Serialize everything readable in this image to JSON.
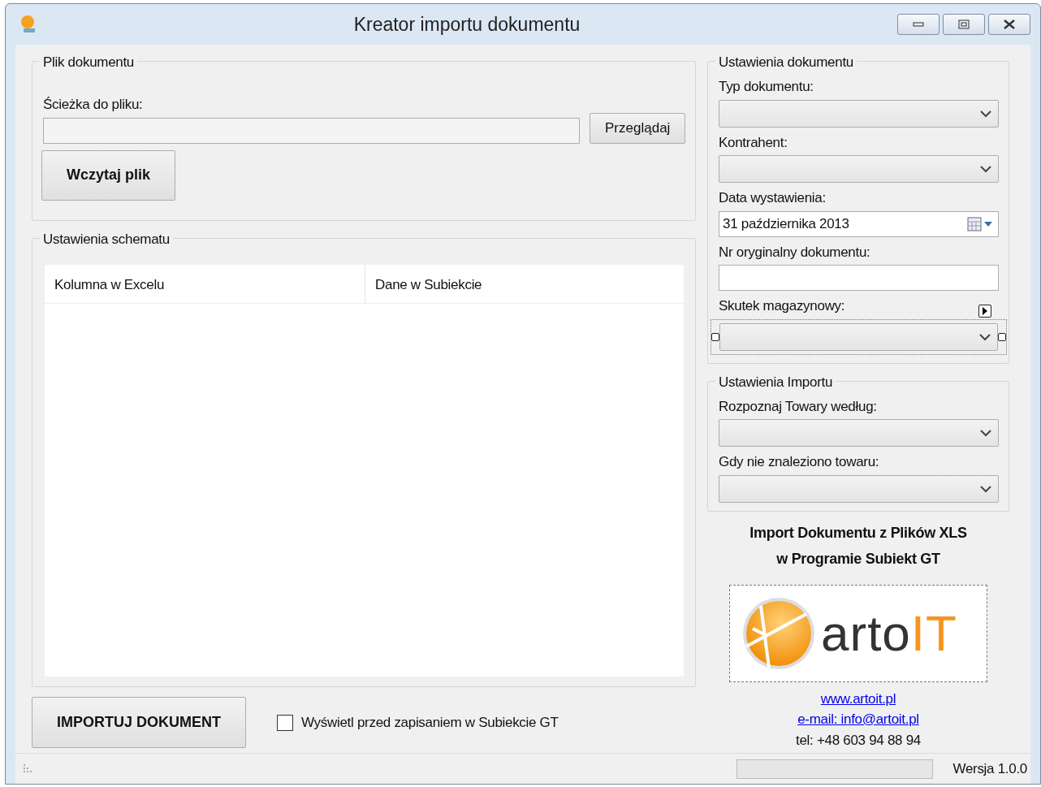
{
  "window": {
    "title": "Kreator importu dokumentu"
  },
  "file_group": {
    "title": "Plik dokumentu",
    "path_label": "Ścieżka do pliku:",
    "browse_button": "Przeglądaj",
    "load_button": "Wczytaj plik"
  },
  "schema_group": {
    "title": "Ustawienia schematu",
    "columns": [
      "Kolumna w Excelu",
      "Dane w Subiekcie"
    ]
  },
  "document_settings": {
    "title": "Ustawienia dokumentu",
    "fields": [
      {
        "kind": "combo",
        "label": "Typ dokumentu:",
        "selected": false
      },
      {
        "kind": "combo",
        "label": "Kontrahent:",
        "selected": false
      },
      {
        "kind": "date",
        "label": "Data wystawienia:",
        "value": "31 października 2013",
        "selected": false
      },
      {
        "kind": "text",
        "label": "Nr oryginalny dokumentu:",
        "selected": false
      },
      {
        "kind": "combo",
        "label": "Skutek magazynowy:",
        "selected": true
      }
    ]
  },
  "import_settings": {
    "title": "Ustawienia Importu",
    "fields": [
      {
        "kind": "combo",
        "label": "Rozpoznaj Towary według:",
        "selected": false
      },
      {
        "kind": "combo",
        "label": "Gdy nie znaleziono towaru:",
        "selected": false
      }
    ]
  },
  "about": {
    "heading_lines": [
      "Import Dokumentu z Plików XLS",
      "w Programie Subiekt GT"
    ],
    "logo_text": "arto",
    "logo_accent": "IT",
    "website": "www.artoit.pl",
    "email": "e-mail: info@artoit.pl",
    "phone": "tel: +48 603 94 88 94"
  },
  "import_button": "IMPORTUJ DOKUMENT",
  "preview_checkbox": {
    "label": "Wyświetl przed zapisaniem w Subiekcie GT",
    "checked": false
  },
  "status_bar": {
    "progress": {
      "level": 0
    },
    "version": "Wersja 1.0.0"
  }
}
